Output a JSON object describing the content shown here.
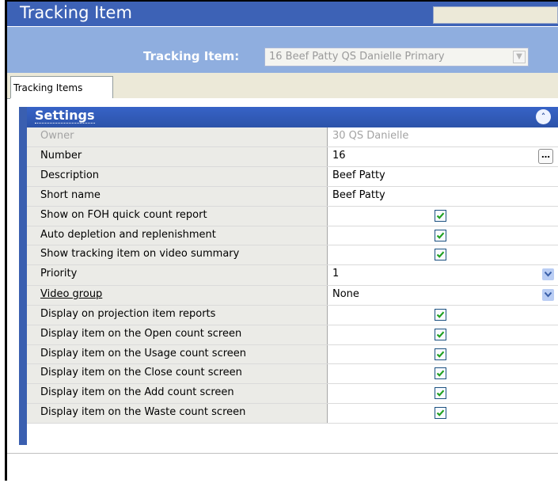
{
  "window": {
    "title": "Tracking Item"
  },
  "selector": {
    "label": "Tracking Item:",
    "value": "16 Beef Patty QS Danielle Primary"
  },
  "tabs": [
    {
      "label": "Tracking Items",
      "active": true
    }
  ],
  "settings": {
    "header": "Settings",
    "rows": [
      {
        "label": "Owner",
        "value": "30  QS Danielle",
        "type": "text",
        "disabled": true
      },
      {
        "label": "Number",
        "value": "16",
        "type": "text-button"
      },
      {
        "label": "Description",
        "value": "Beef Patty",
        "type": "text"
      },
      {
        "label": "Short name",
        "value": "Beef Patty",
        "type": "text"
      },
      {
        "label": "Show on FOH quick count report",
        "checked": true,
        "type": "checkbox"
      },
      {
        "label": "Auto depletion and replenishment",
        "checked": true,
        "type": "checkbox"
      },
      {
        "label": "Show tracking item on video summary",
        "checked": true,
        "type": "checkbox"
      },
      {
        "label": "Priority",
        "value": "1",
        "type": "dropdown"
      },
      {
        "label": "Video group",
        "value": "None",
        "type": "dropdown",
        "underlined": true
      },
      {
        "label": "Display on projection item reports",
        "checked": true,
        "type": "checkbox"
      },
      {
        "label": "Display item on the Open count screen",
        "checked": true,
        "type": "checkbox"
      },
      {
        "label": "Display item on the Usage count screen",
        "checked": true,
        "type": "checkbox"
      },
      {
        "label": "Display item on the Close count screen",
        "checked": true,
        "type": "checkbox"
      },
      {
        "label": "Display item on the Add count screen",
        "checked": true,
        "type": "checkbox"
      },
      {
        "label": "Display item on the Waste count screen",
        "checked": true,
        "type": "checkbox"
      }
    ]
  },
  "colors": {
    "title_bar": "#3d62b6",
    "selector_bar": "#8faedf",
    "settings_header": "#2c53a9",
    "label_cell": "#ebebe7"
  }
}
